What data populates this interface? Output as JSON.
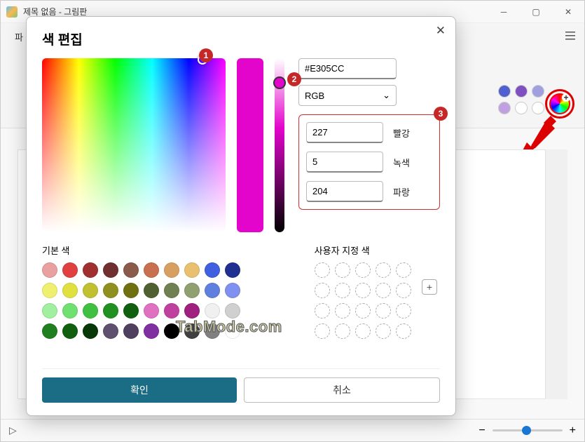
{
  "app": {
    "title": "제목 없음 - 그림판",
    "file_tab_prefix": "파"
  },
  "dialog": {
    "title": "색 편집",
    "hex_value": "#E305CC",
    "model_label": "RGB",
    "channels": {
      "r_label": "빨강",
      "r_value": "227",
      "g_label": "녹색",
      "g_value": "5",
      "b_label": "파랑",
      "b_value": "204"
    },
    "basic_colors_label": "기본 색",
    "custom_colors_label": "사용자 지정 색",
    "ok_label": "확인",
    "cancel_label": "취소",
    "basic_colors": [
      "#e8a0a0",
      "#e04040",
      "#a03030",
      "#703030",
      "#8a5a4a",
      "#c87050",
      "#d8a060",
      "#e8c070",
      "#4060e0",
      "#203090",
      "#f0f070",
      "#e0e040",
      "#c0c030",
      "#909020",
      "#707010",
      "#506030",
      "#708050",
      "#90a070",
      "#6080e0",
      "#8090f0",
      "#a0f0a0",
      "#70e070",
      "#40c040",
      "#209020",
      "#106010",
      "#e070c0",
      "#c040a0",
      "#a02080",
      "#f0f0f0",
      "#d0d0d0",
      "#208020",
      "#106010",
      "#083808",
      "#605070",
      "#504060",
      "#8030a0",
      "#000000",
      "#404040",
      "#808080",
      "#ffffff"
    ],
    "annotations": {
      "a1": "1",
      "a2": "2",
      "a3": "3"
    }
  },
  "palette_preview": [
    "#5060d0",
    "#8050c0",
    "#a0a0e0",
    "#c0a0e0",
    "#ffffff",
    "#ffffff"
  ],
  "watermark": "TabMode.com",
  "zoom": {
    "minus": "−",
    "plus": "+"
  }
}
